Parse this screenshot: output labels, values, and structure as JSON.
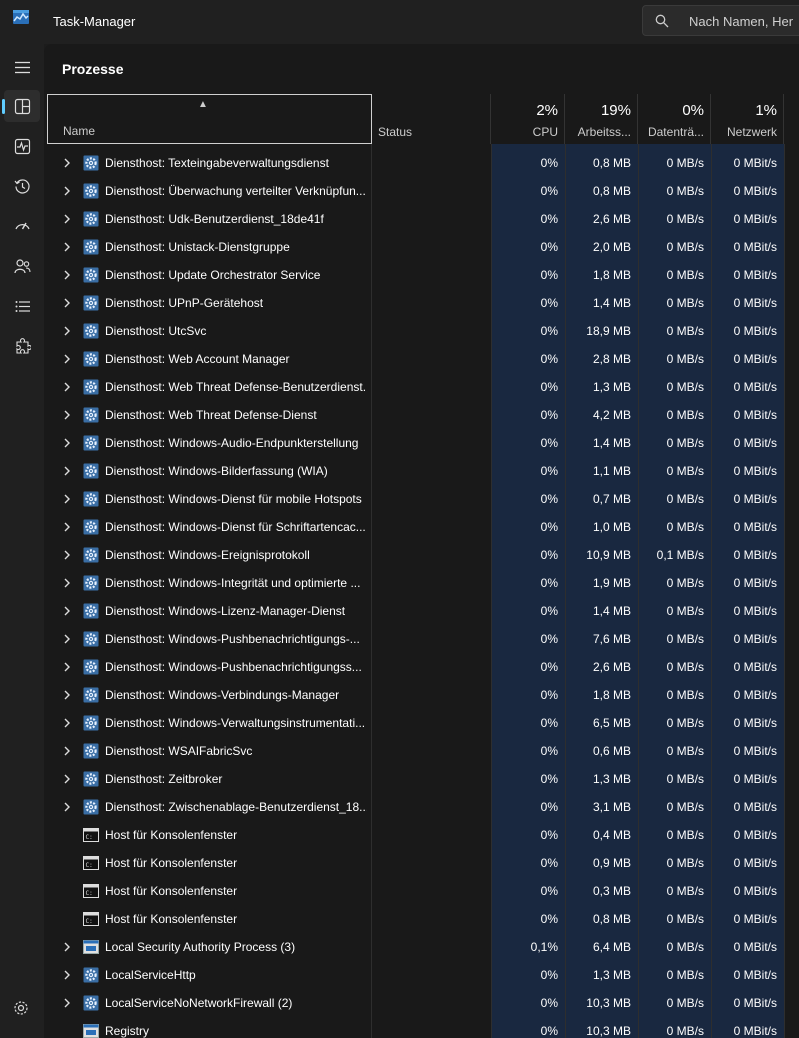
{
  "app": {
    "title": "Task-Manager"
  },
  "search": {
    "placeholder": "Nach Namen, Her"
  },
  "sidebar": {
    "items": [
      {
        "name": "hamburger-menu"
      },
      {
        "name": "processes",
        "active": true
      },
      {
        "name": "performance"
      },
      {
        "name": "app-history"
      },
      {
        "name": "startup-apps"
      },
      {
        "name": "users"
      },
      {
        "name": "details"
      },
      {
        "name": "services"
      }
    ]
  },
  "page": {
    "title": "Prozesse"
  },
  "table": {
    "columns": {
      "name": "Name",
      "status": "Status",
      "cpu": {
        "pct": "2%",
        "label": "CPU"
      },
      "memory": {
        "pct": "19%",
        "label": "Arbeitss..."
      },
      "disk": {
        "pct": "0%",
        "label": "Datenträ..."
      },
      "network": {
        "pct": "1%",
        "label": "Netzwerk"
      }
    },
    "rows": [
      {
        "name": "Diensthost: Texteingabeverwaltungsdienst",
        "expandable": true,
        "icon": "gear-icon",
        "cpu": "0%",
        "mem": "0,8 MB",
        "disk": "0 MB/s",
        "net": "0 MBit/s"
      },
      {
        "name": "Diensthost: Überwachung verteilter Verknüpfun...",
        "expandable": true,
        "icon": "gear-icon",
        "cpu": "0%",
        "mem": "0,8 MB",
        "disk": "0 MB/s",
        "net": "0 MBit/s"
      },
      {
        "name": "Diensthost: Udk-Benutzerdienst_18de41f",
        "expandable": true,
        "icon": "gear-icon",
        "cpu": "0%",
        "mem": "2,6 MB",
        "disk": "0 MB/s",
        "net": "0 MBit/s"
      },
      {
        "name": "Diensthost: Unistack-Dienstgruppe",
        "expandable": true,
        "icon": "gear-icon",
        "cpu": "0%",
        "mem": "2,0 MB",
        "disk": "0 MB/s",
        "net": "0 MBit/s"
      },
      {
        "name": "Diensthost: Update Orchestrator Service",
        "expandable": true,
        "icon": "gear-icon",
        "cpu": "0%",
        "mem": "1,8 MB",
        "disk": "0 MB/s",
        "net": "0 MBit/s"
      },
      {
        "name": "Diensthost: UPnP-Gerätehost",
        "expandable": true,
        "icon": "gear-icon",
        "cpu": "0%",
        "mem": "1,4 MB",
        "disk": "0 MB/s",
        "net": "0 MBit/s"
      },
      {
        "name": "Diensthost: UtcSvc",
        "expandable": true,
        "icon": "gear-icon",
        "cpu": "0%",
        "mem": "18,9 MB",
        "disk": "0 MB/s",
        "net": "0 MBit/s"
      },
      {
        "name": "Diensthost: Web Account Manager",
        "expandable": true,
        "icon": "gear-icon",
        "cpu": "0%",
        "mem": "2,8 MB",
        "disk": "0 MB/s",
        "net": "0 MBit/s"
      },
      {
        "name": "Diensthost: Web Threat Defense-Benutzerdienst...",
        "expandable": true,
        "icon": "gear-icon",
        "cpu": "0%",
        "mem": "1,3 MB",
        "disk": "0 MB/s",
        "net": "0 MBit/s"
      },
      {
        "name": "Diensthost: Web Threat Defense-Dienst",
        "expandable": true,
        "icon": "gear-icon",
        "cpu": "0%",
        "mem": "4,2 MB",
        "disk": "0 MB/s",
        "net": "0 MBit/s"
      },
      {
        "name": "Diensthost: Windows-Audio-Endpunkterstellung",
        "expandable": true,
        "icon": "gear-icon",
        "cpu": "0%",
        "mem": "1,4 MB",
        "disk": "0 MB/s",
        "net": "0 MBit/s"
      },
      {
        "name": "Diensthost: Windows-Bilderfassung (WIA)",
        "expandable": true,
        "icon": "gear-icon",
        "cpu": "0%",
        "mem": "1,1 MB",
        "disk": "0 MB/s",
        "net": "0 MBit/s"
      },
      {
        "name": "Diensthost: Windows-Dienst für mobile Hotspots",
        "expandable": true,
        "icon": "gear-icon",
        "cpu": "0%",
        "mem": "0,7 MB",
        "disk": "0 MB/s",
        "net": "0 MBit/s"
      },
      {
        "name": "Diensthost: Windows-Dienst für Schriftartencac...",
        "expandable": true,
        "icon": "gear-icon",
        "cpu": "0%",
        "mem": "1,0 MB",
        "disk": "0 MB/s",
        "net": "0 MBit/s"
      },
      {
        "name": "Diensthost: Windows-Ereignisprotokoll",
        "expandable": true,
        "icon": "gear-icon",
        "cpu": "0%",
        "mem": "10,9 MB",
        "disk": "0,1 MB/s",
        "net": "0 MBit/s"
      },
      {
        "name": "Diensthost: Windows-Integrität und optimierte ...",
        "expandable": true,
        "icon": "gear-icon",
        "cpu": "0%",
        "mem": "1,9 MB",
        "disk": "0 MB/s",
        "net": "0 MBit/s"
      },
      {
        "name": "Diensthost: Windows-Lizenz-Manager-Dienst",
        "expandable": true,
        "icon": "gear-icon",
        "cpu": "0%",
        "mem": "1,4 MB",
        "disk": "0 MB/s",
        "net": "0 MBit/s"
      },
      {
        "name": "Diensthost: Windows-Pushbenachrichtigungs-...",
        "expandable": true,
        "icon": "gear-icon",
        "cpu": "0%",
        "mem": "7,6 MB",
        "disk": "0 MB/s",
        "net": "0 MBit/s"
      },
      {
        "name": "Diensthost: Windows-Pushbenachrichtigungss...",
        "expandable": true,
        "icon": "gear-icon",
        "cpu": "0%",
        "mem": "2,6 MB",
        "disk": "0 MB/s",
        "net": "0 MBit/s"
      },
      {
        "name": "Diensthost: Windows-Verbindungs-Manager",
        "expandable": true,
        "icon": "gear-icon",
        "cpu": "0%",
        "mem": "1,8 MB",
        "disk": "0 MB/s",
        "net": "0 MBit/s"
      },
      {
        "name": "Diensthost: Windows-Verwaltungsinstrumentati...",
        "expandable": true,
        "icon": "gear-icon",
        "cpu": "0%",
        "mem": "6,5 MB",
        "disk": "0 MB/s",
        "net": "0 MBit/s"
      },
      {
        "name": "Diensthost: WSAIFabricSvc",
        "expandable": true,
        "icon": "gear-icon",
        "cpu": "0%",
        "mem": "0,6 MB",
        "disk": "0 MB/s",
        "net": "0 MBit/s"
      },
      {
        "name": "Diensthost: Zeitbroker",
        "expandable": true,
        "icon": "gear-icon",
        "cpu": "0%",
        "mem": "1,3 MB",
        "disk": "0 MB/s",
        "net": "0 MBit/s"
      },
      {
        "name": "Diensthost: Zwischenablage-Benutzerdienst_18...",
        "expandable": true,
        "icon": "gear-icon",
        "cpu": "0%",
        "mem": "3,1 MB",
        "disk": "0 MB/s",
        "net": "0 MBit/s"
      },
      {
        "name": "Host für Konsolenfenster",
        "expandable": false,
        "icon": "console-icon",
        "cpu": "0%",
        "mem": "0,4 MB",
        "disk": "0 MB/s",
        "net": "0 MBit/s"
      },
      {
        "name": "Host für Konsolenfenster",
        "expandable": false,
        "icon": "console-icon",
        "cpu": "0%",
        "mem": "0,9 MB",
        "disk": "0 MB/s",
        "net": "0 MBit/s"
      },
      {
        "name": "Host für Konsolenfenster",
        "expandable": false,
        "icon": "console-icon",
        "cpu": "0%",
        "mem": "0,3 MB",
        "disk": "0 MB/s",
        "net": "0 MBit/s"
      },
      {
        "name": "Host für Konsolenfenster",
        "expandable": false,
        "icon": "console-icon",
        "cpu": "0%",
        "mem": "0,8 MB",
        "disk": "0 MB/s",
        "net": "0 MBit/s"
      },
      {
        "name": "Local Security Authority Process (3)",
        "expandable": true,
        "icon": "window-icon",
        "cpu": "0,1%",
        "mem": "6,4 MB",
        "disk": "0 MB/s",
        "net": "0 MBit/s"
      },
      {
        "name": "LocalServiceHttp",
        "expandable": true,
        "icon": "gear-icon",
        "cpu": "0%",
        "mem": "1,3 MB",
        "disk": "0 MB/s",
        "net": "0 MBit/s"
      },
      {
        "name": "LocalServiceNoNetworkFirewall (2)",
        "expandable": true,
        "icon": "gear-icon",
        "cpu": "0%",
        "mem": "10,3 MB",
        "disk": "0 MB/s",
        "net": "0 MBit/s"
      },
      {
        "name": "Registry",
        "expandable": false,
        "icon": "window-icon",
        "cpu": "0%",
        "mem": "10,3 MB",
        "disk": "0 MB/s",
        "net": "0 MBit/s"
      }
    ]
  },
  "colors": {
    "accent": "#60cdff",
    "column_highlight": "#192840",
    "background": "#1c1c1c"
  }
}
